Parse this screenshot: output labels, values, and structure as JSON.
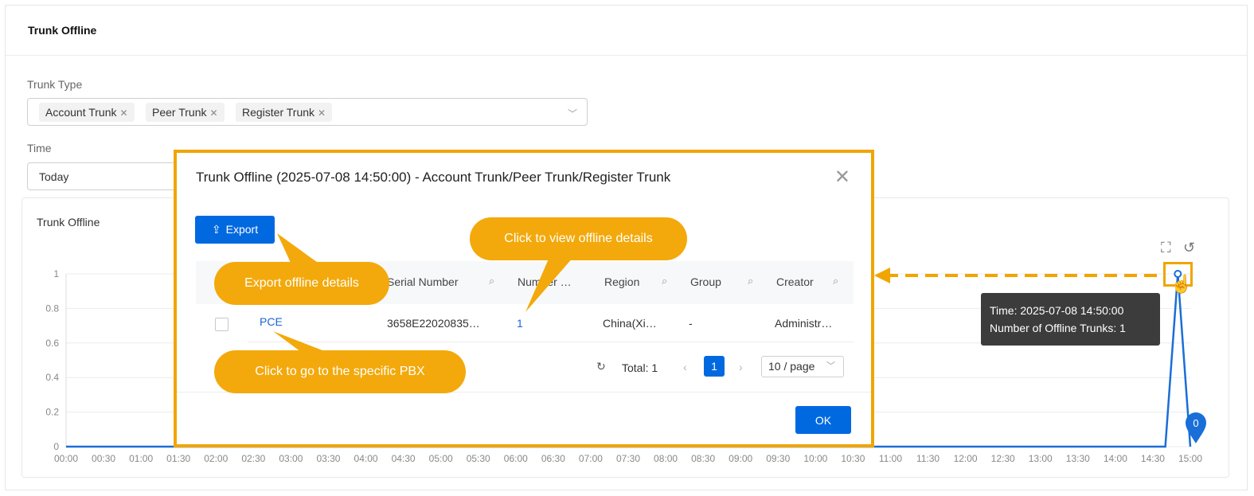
{
  "page": {
    "title": "Trunk Offline",
    "trunk_type_label": "Trunk Type",
    "trunk_type_tags": [
      "Account Trunk",
      "Peer Trunk",
      "Register Trunk"
    ],
    "time_label": "Time",
    "time_value": "Today"
  },
  "chart": {
    "title": "Trunk Offline",
    "tooltip_line1": "Time: 2025-07-08 14:50:00",
    "tooltip_line2": "Number of Offline Trunks: 1",
    "marker_label": "0"
  },
  "chart_data": {
    "type": "line",
    "title": "Trunk Offline",
    "x_ticks": [
      "00:00",
      "00:30",
      "01:00",
      "01:30",
      "02:00",
      "02:30",
      "03:00",
      "03:30",
      "04:00",
      "04:30",
      "05:00",
      "05:30",
      "06:00",
      "06:30",
      "07:00",
      "07:30",
      "08:00",
      "08:30",
      "09:00",
      "09:30",
      "10:00",
      "10:30",
      "11:00",
      "11:30",
      "12:00",
      "12:30",
      "13:00",
      "13:30",
      "14:00",
      "14:30",
      "15:00"
    ],
    "y_ticks": [
      "0",
      "0.2",
      "0.4",
      "0.6",
      "0.8",
      "1"
    ],
    "ylim": [
      0,
      1
    ],
    "series": [
      {
        "x": [
          "00:00",
          "14:40",
          "14:50",
          "15:00"
        ],
        "values": [
          0,
          0,
          1,
          0
        ]
      }
    ],
    "grid": true
  },
  "modal": {
    "title": "Trunk Offline (2025-07-08 14:50:00) - Account Trunk/Peer Trunk/Register Trunk",
    "export_label": "Export",
    "columns": [
      "Serial Number",
      "Number …",
      "Region",
      "Group",
      "Creator"
    ],
    "row": {
      "name": "PCE",
      "serial": "3658E22020835…",
      "number": "1",
      "region": "China(Xi…",
      "group": "-",
      "creator": "Administr…"
    },
    "total": "Total: 1",
    "current_page": "1",
    "page_size": "10 / page",
    "ok_label": "OK"
  },
  "callouts": {
    "export": "Export offline details",
    "view": "Click to view offline details",
    "pbx": "Click to go to the specific PBX"
  },
  "colors": {
    "accent": "#0069e0",
    "highlight": "#f0a500",
    "callout": "#f3a90b"
  }
}
